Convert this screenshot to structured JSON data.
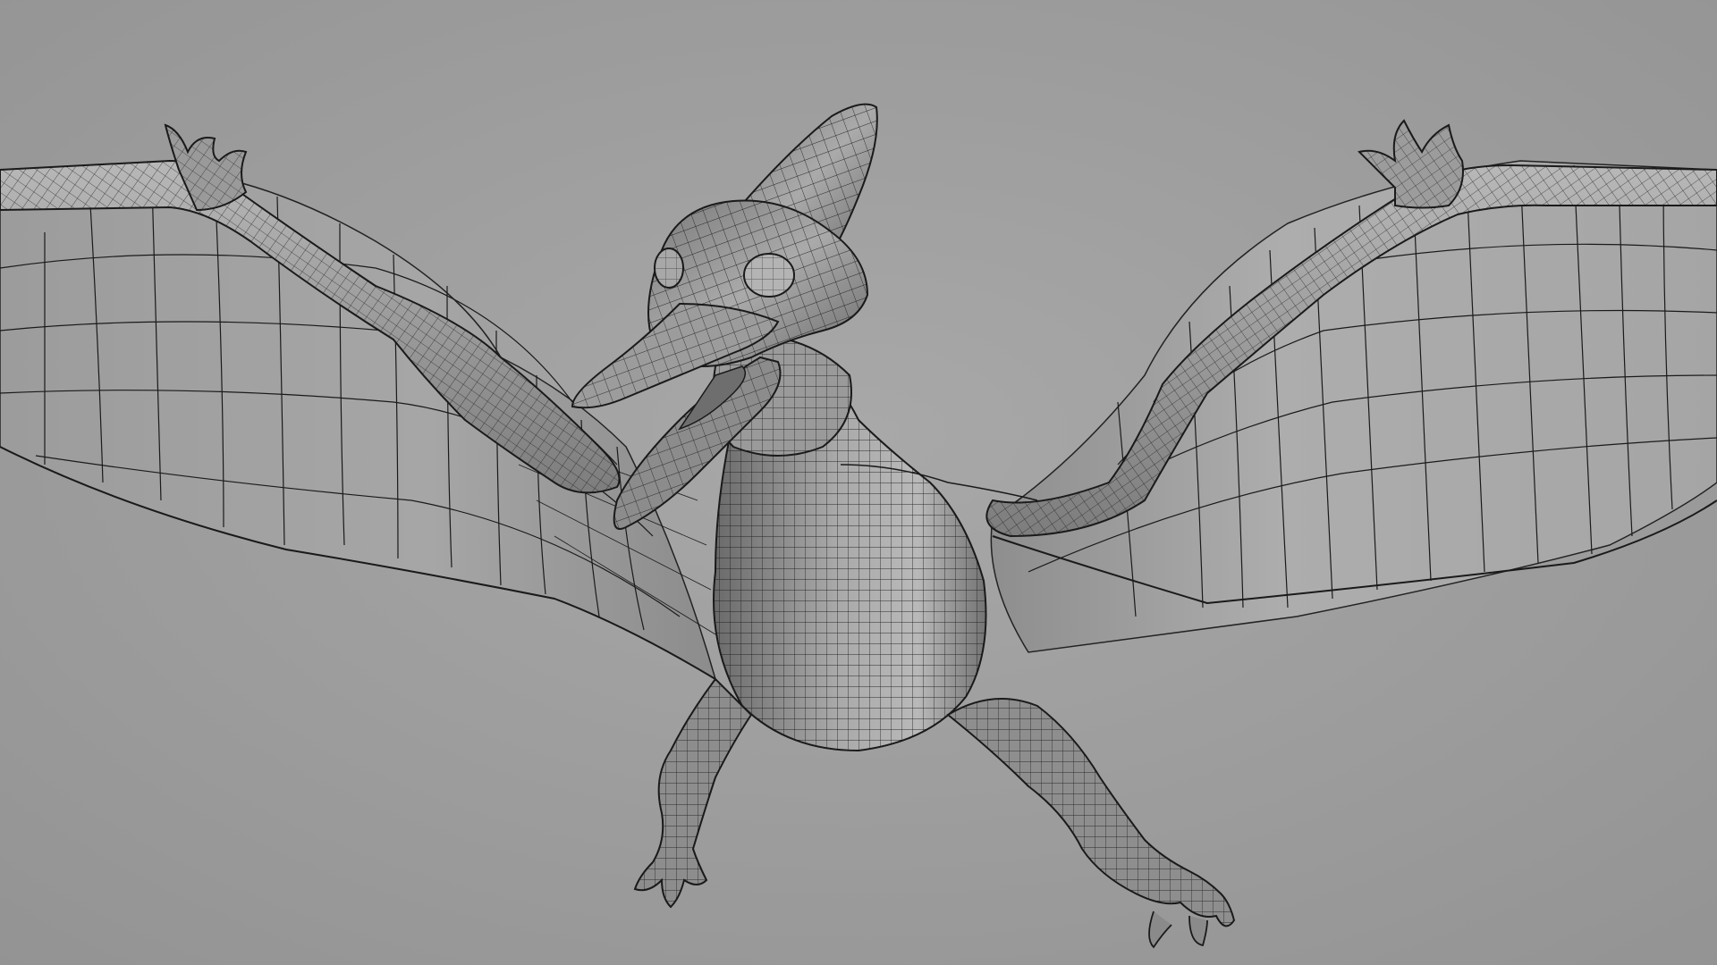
{
  "scene": {
    "subject_icon": "pterodactyl-wireframe-icon",
    "render_style": "clay shaded with quad wireframe overlay",
    "colors": {
      "background": "#9a9a9a",
      "background_light": "#a6a6a6",
      "mesh_fill": "#8f8f8f",
      "mesh_highlight": "#bdbdbd",
      "mesh_shadow": "#5e5e5e",
      "wing_membrane": "#a2a2a2",
      "wireframe": "#1a1a1a"
    }
  }
}
